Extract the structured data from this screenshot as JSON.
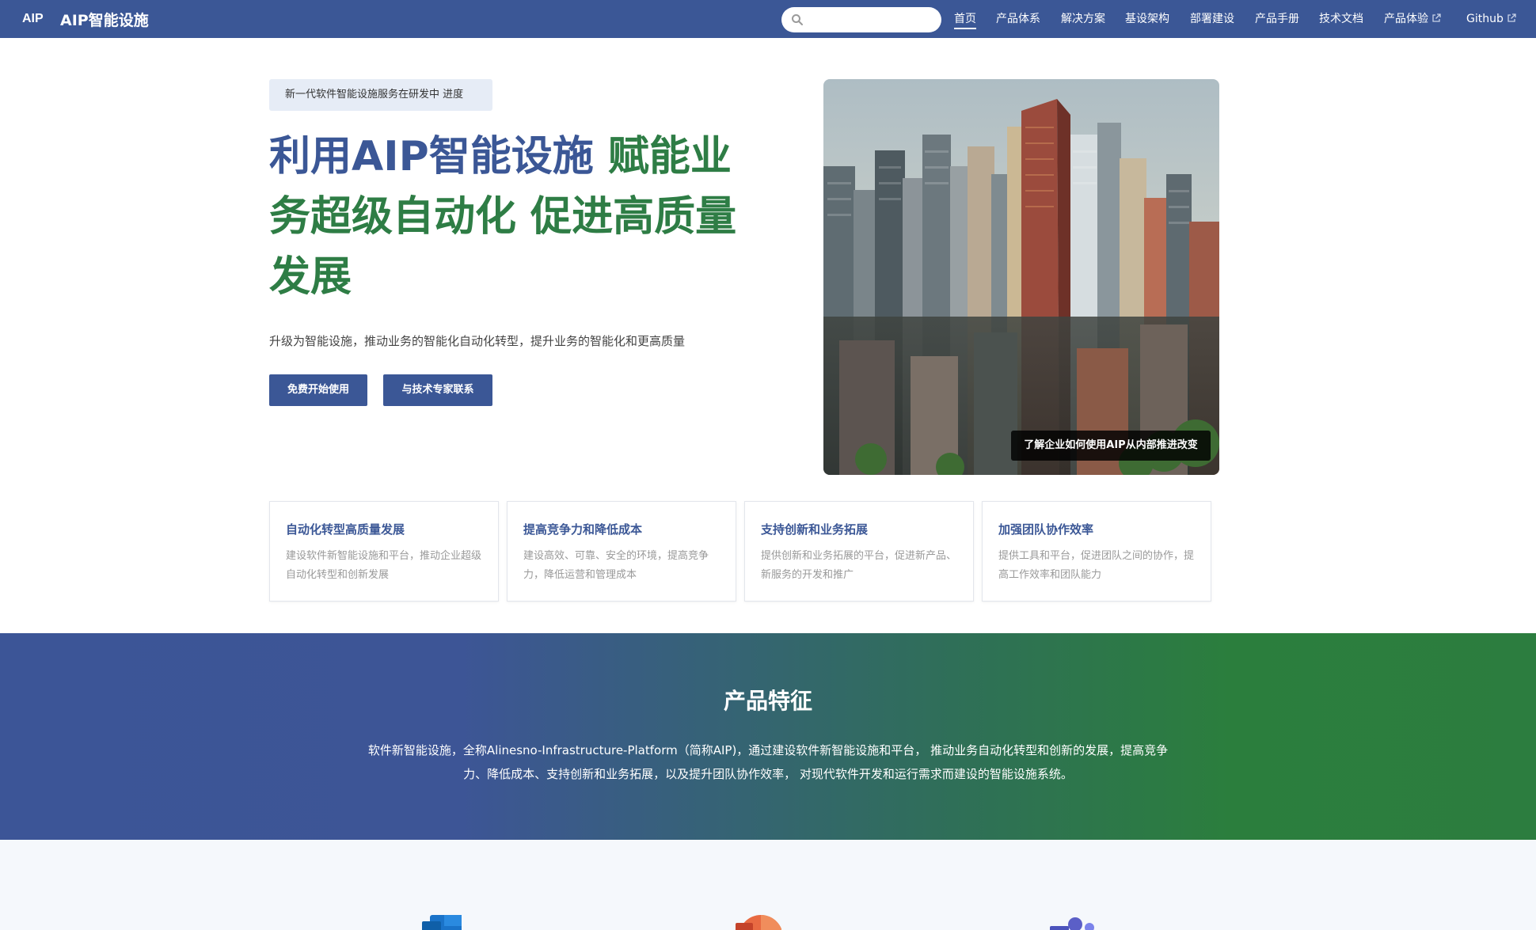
{
  "header": {
    "logo_text": "AIP",
    "title": "AIP智能设施",
    "search_placeholder": "",
    "nav": [
      {
        "label": "首页",
        "active": true
      },
      {
        "label": "产品体系"
      },
      {
        "label": "解决方案"
      },
      {
        "label": "基设架构"
      },
      {
        "label": "部署建设"
      },
      {
        "label": "产品手册"
      },
      {
        "label": "技术文档"
      },
      {
        "label": "产品体验",
        "external": true
      },
      {
        "label": "Github",
        "external": true
      }
    ]
  },
  "hero": {
    "badge": "新一代软件智能设施服务在研发中 进度",
    "title_part1": "利用AIP智能设施 ",
    "title_part2": "赋能业务超级自动化 促进高质量发展",
    "subtitle": "升级为智能设施，推动业务的智能化自动化转型，提升业务的智能化和更高质量",
    "primary_button": "免费开始使用",
    "secondary_button": "与技术专家联系",
    "image_caption": "了解企业如何使用AIP从内部推进改变"
  },
  "feature_cards": [
    {
      "title": "自动化转型高质量发展",
      "desc": "建设软件新智能设施和平台，推动企业超级自动化转型和创新发展"
    },
    {
      "title": "提高竞争力和降低成本",
      "desc": "建设高效、可靠、安全的环境，提高竞争力，降低运营和管理成本"
    },
    {
      "title": "支持创新和业务拓展",
      "desc": "提供创新和业务拓展的平台，促进新产品、新服务的开发和推广"
    },
    {
      "title": "加强团队协作效率",
      "desc": "提供工具和平台，促进团队之间的协作，提高工作效率和团队能力"
    }
  ],
  "features_band": {
    "title": "产品特征",
    "text": "软件新智能设施，全称Alinesno-Infrastructure-Platform（简称AIP)，通过建设软件新智能设施和平台， 推动业务自动化转型和创新的发展，提高竞争力、降低成本、支持创新和业务拓展，以及提升团队协作效率， 对现代软件开发和运行需求而建设的智能设施系统。"
  },
  "bottom_icons": [
    "outlook-icon",
    "powerpoint-icon",
    "teams-icon"
  ],
  "colors": {
    "brand_blue": "#3b5796",
    "brand_green": "#2e7d45",
    "badge_bg": "#e6ecf6"
  }
}
